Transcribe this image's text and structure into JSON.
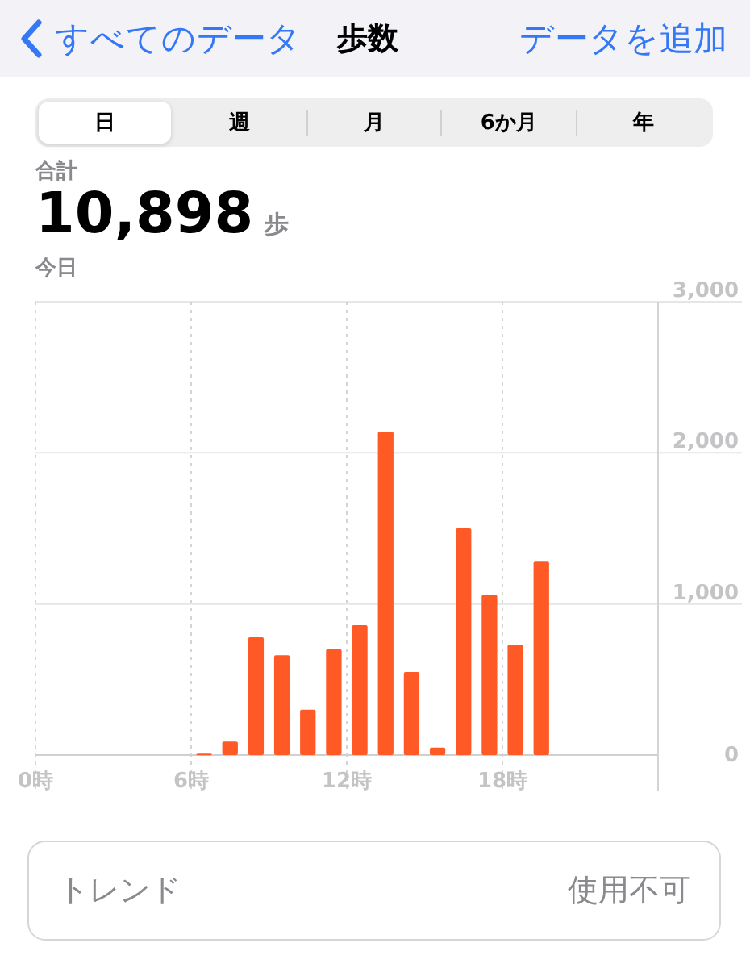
{
  "nav": {
    "back": "すべてのデータ",
    "title": "歩数",
    "action": "データを追加"
  },
  "tabs": [
    {
      "label": "日",
      "selected": true
    },
    {
      "label": "週",
      "selected": false
    },
    {
      "label": "月",
      "selected": false
    },
    {
      "label": "6か月",
      "selected": false
    },
    {
      "label": "年",
      "selected": false
    }
  ],
  "summary": {
    "label": "合計",
    "value": "10,898",
    "unit": "歩",
    "date": "今日"
  },
  "chart_data": {
    "type": "bar",
    "x": [
      6.5,
      7.5,
      8.5,
      9.5,
      10.5,
      11.5,
      12.5,
      13.5,
      14.5,
      15.5,
      16.5,
      17.5,
      18.5,
      19.5
    ],
    "series": [
      {
        "color": "#ff5a26",
        "values": [
          10,
          90,
          780,
          660,
          300,
          700,
          860,
          2140,
          550,
          50,
          1500,
          1060,
          730,
          1280
        ]
      }
    ],
    "grid": true,
    "xticks": [
      {
        "value": 0,
        "label": "0時"
      },
      {
        "value": 6,
        "label": "6時"
      },
      {
        "value": 12,
        "label": "12時"
      },
      {
        "value": 18,
        "label": "18時"
      }
    ],
    "yticks": [
      {
        "value": 0,
        "label": "0"
      },
      {
        "value": 1000,
        "label": "1,000"
      },
      {
        "value": 2000,
        "label": "2,000"
      },
      {
        "value": 3000,
        "label": "3,000"
      }
    ],
    "ylim": [
      0,
      3000
    ],
    "xlim": [
      0,
      24
    ]
  },
  "trend": {
    "label": "トレンド",
    "value": "使用不可"
  }
}
